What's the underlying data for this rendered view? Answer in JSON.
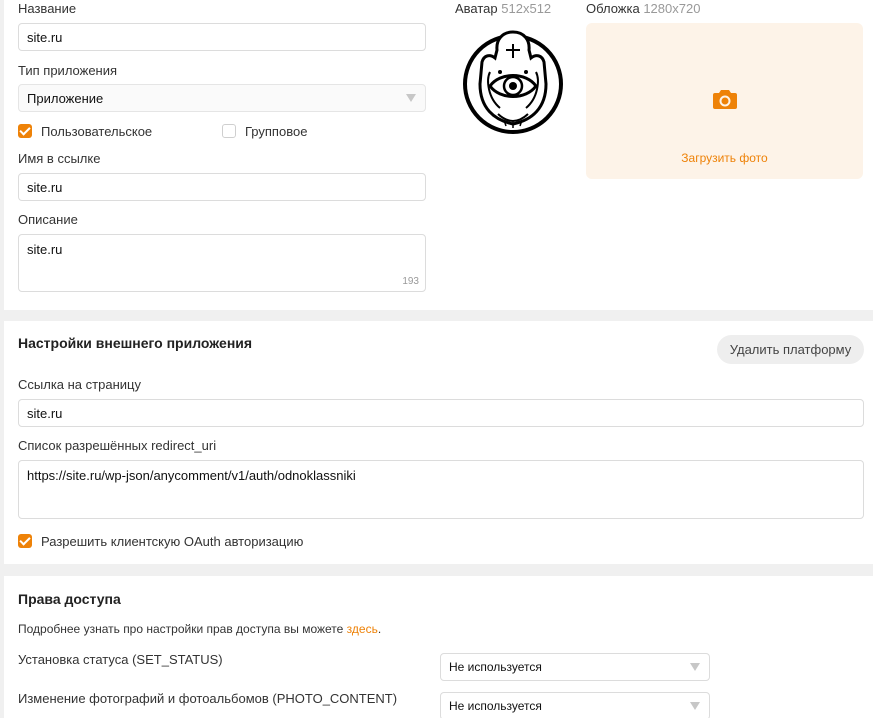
{
  "app_form": {
    "name_label": "Название",
    "name_value": "site.ru",
    "type_label": "Тип приложения",
    "type_value": "Приложение",
    "checkbox_user_label": "Пользовательское",
    "checkbox_user_checked": true,
    "checkbox_group_label": "Групповое",
    "checkbox_group_checked": false,
    "link_name_label": "Имя в ссылке",
    "link_name_value": "site.ru",
    "description_label": "Описание",
    "description_value": "site.ru",
    "description_counter": "193",
    "avatar_label": "Аватар",
    "avatar_size": "512x512",
    "cover_label": "Обложка",
    "cover_size": "1280x720",
    "upload_photo_label": "Загрузить фото"
  },
  "external_settings": {
    "title": "Настройки внешнего приложения",
    "delete_platform_label": "Удалить платформу",
    "page_link_label": "Ссылка на страницу",
    "page_link_value": "site.ru",
    "redirect_label": "Список разрешённых redirect_uri",
    "redirect_value": "https://site.ru/wp-json/anycomment/v1/auth/odnoklassniki",
    "oauth_label": "Разрешить клиентскую OAuth авторизацию",
    "oauth_checked": true
  },
  "permissions": {
    "title": "Права доступа",
    "info_text": "Подробнее узнать про настройки прав доступа вы можете ",
    "info_link": "здесь",
    "info_suffix": ".",
    "rows": [
      {
        "label": "Установка статуса (SET_STATUS)",
        "value": "Не используется"
      },
      {
        "label": "Изменение фотографий и фотоальбомов (PHOTO_CONTENT)",
        "value": "Не используется"
      }
    ]
  },
  "colors": {
    "accent": "#ee8208",
    "page_bg": "#f0f0f0",
    "cover_bg": "#fdf3e8"
  },
  "icons": {
    "avatar": "hamsa-eye-logo",
    "upload": "camera-icon"
  }
}
